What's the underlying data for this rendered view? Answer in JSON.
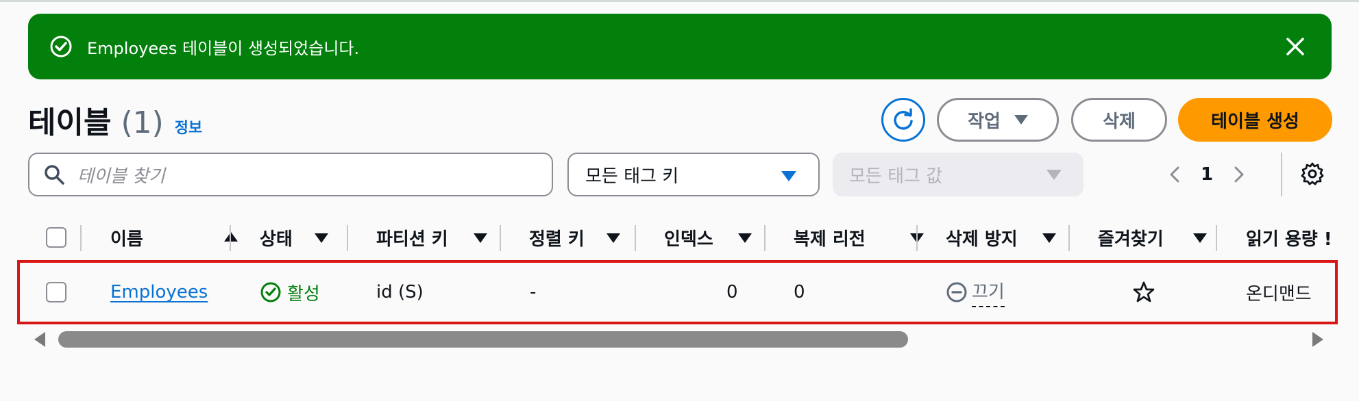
{
  "flash": {
    "message": "Employees 테이블이 생성되었습니다.",
    "color": "#037f0c"
  },
  "header": {
    "title": "테이블",
    "count": "(1)",
    "info_link": "정보"
  },
  "actions": {
    "action_label": "작업",
    "delete_label": "삭제",
    "create_label": "테이블 생성",
    "create_color": "#ff9900"
  },
  "filters": {
    "search_placeholder": "테이블 찾기",
    "tag_key_value": "모든 태그 키",
    "tag_value_placeholder": "모든 태그 값"
  },
  "pagination": {
    "current_page": "1"
  },
  "table": {
    "columns": [
      "이름",
      "상태",
      "파티션 키",
      "정렬 키",
      "인덱스",
      "복제 리전",
      "삭제 방지",
      "즐겨찾기",
      "읽기 용량 !"
    ],
    "rows": [
      {
        "name": "Employees",
        "status": "활성",
        "partition_key": "id (S)",
        "sort_key": "-",
        "indexes": "0",
        "replica_regions": "0",
        "deletion_protection": "끄기",
        "read_capacity": "온디맨드"
      }
    ]
  }
}
